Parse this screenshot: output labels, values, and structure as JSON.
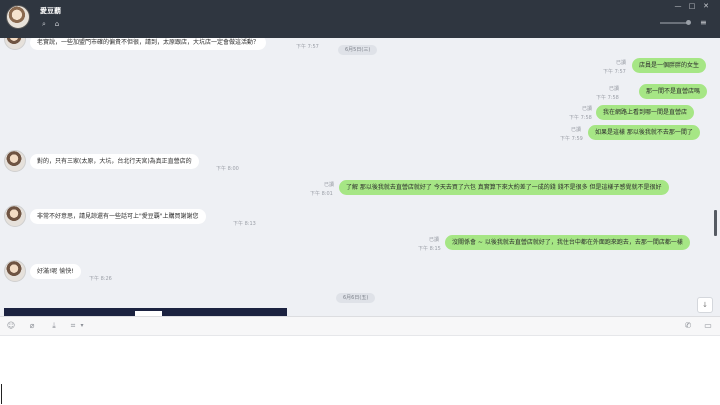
{
  "app": {
    "contact_name": "愛豆覇",
    "accent_color": "#2f3640",
    "out_bubble_color": "#a6e685",
    "in_bubble_color": "#ffffff"
  },
  "header": {
    "icons": [
      "search-icon",
      "home-icon",
      "minimize-icon",
      "maximize-icon",
      "close-icon",
      "volume-slider",
      "menu-icon"
    ],
    "min_glyph": "—",
    "max_glyph": "□",
    "close_glyph": "✕",
    "search_glyph": "⌕",
    "home_glyph": "⌂",
    "menu_glyph": "≡"
  },
  "chat": {
    "date_1": "6月5日(三)",
    "date_2": "6月6日(五)",
    "messages": [
      {
        "side": "in",
        "text": "老實說，一些加盟門市確的偏貴不但很，請到，太原跟店，大坑店一定會做這活動？",
        "time": "下午 7:57"
      },
      {
        "side": "out",
        "text": "店員是一個胖胖的女生",
        "read": "已讀",
        "time": "下午 7:57"
      },
      {
        "side": "out",
        "text": "那一間不是直營店嗎",
        "read": "已讀",
        "time": "下午 7:58"
      },
      {
        "side": "out",
        "text": "我在網路上看到哪一間是直營店",
        "read": "已讀",
        "time": "下午 7:58"
      },
      {
        "side": "out",
        "text": "如果是這樣 那以後我就不去那一間了",
        "read": "已讀",
        "time": "下午 7:59"
      },
      {
        "side": "in",
        "text": "對的，只有三家(太原，大坑，台北行天宮)為真正直營店的",
        "time": "下午 8:00"
      },
      {
        "side": "out",
        "text": "了解 那以後我就去直營店就好了  今天去買了六包 真實算下來大約差了一成的錢  錢不是很多 但是這樣子感覺就不是很好",
        "read": "已讀",
        "time": "下午 8:01"
      },
      {
        "side": "in",
        "text": "非常不好意思，請見諒還有一些話可上\"愛豆覇\"上購買謝謝您",
        "time": "下午 8:13"
      },
      {
        "side": "out",
        "text": "沒關係會 ~ 以後我就去直營店就好了，我住台中都在外面跑來跑去，去那一間店都一樣",
        "read": "已讀",
        "time": "下午 8:15"
      },
      {
        "side": "in",
        "text": "好滿!呢 愉快!",
        "time": "下午 8:26"
      }
    ]
  },
  "toolbar": {
    "icons": [
      "emoji-icon",
      "attach-icon",
      "download-icon",
      "crop-icon",
      "phone-icon",
      "video-icon"
    ],
    "emoji_glyph": "☺",
    "attach_glyph": "⌀",
    "download_glyph": "⤓",
    "crop_glyph": "⌗",
    "crop_caret": "▾",
    "phone_glyph": "✆",
    "video_glyph": "▭"
  },
  "scroll_down_glyph": "↓",
  "input": {
    "placeholder": "",
    "value": ""
  }
}
